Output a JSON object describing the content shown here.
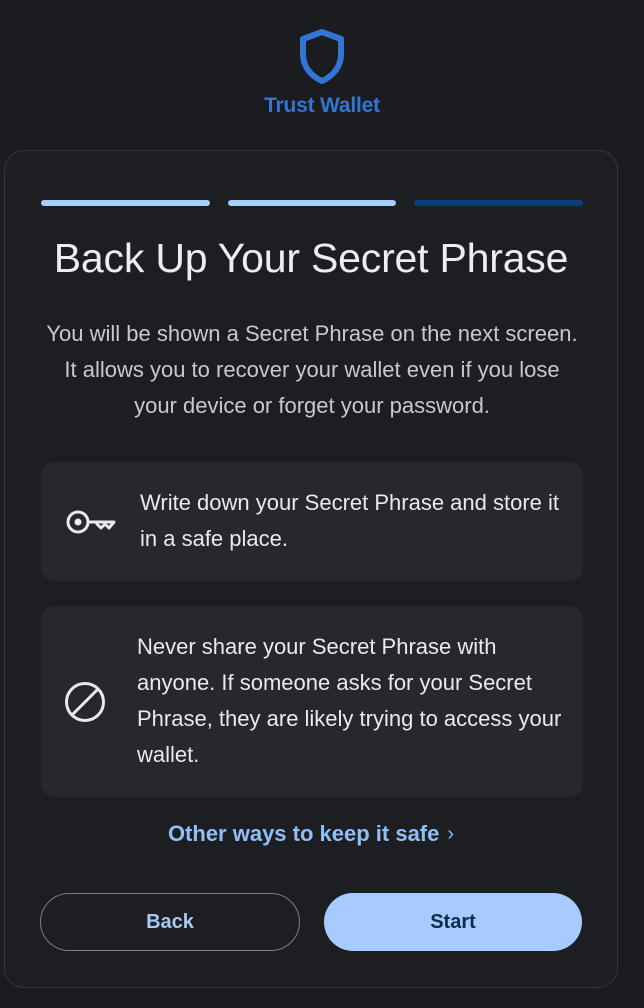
{
  "brand": {
    "name": "Trust Wallet",
    "logo_icon": "shield-icon",
    "color": "#3276d5"
  },
  "progress": {
    "total_steps": 3,
    "completed_steps": 2,
    "done_color": "#a9cdfb",
    "pending_color": "#0b3f78"
  },
  "main": {
    "title": "Back Up Your Secret Phrase",
    "subtitle": "You will be shown a Secret Phrase on the next screen. It allows you to recover your wallet even if you lose your device or forget your password."
  },
  "tips": [
    {
      "icon": "key-icon",
      "text": "Write down your Secret Phrase and store it in a safe place."
    },
    {
      "icon": "prohibited-icon",
      "text": "Never share your Secret Phrase with anyone. If someone asks for your Secret Phrase, they are likely trying to access your wallet."
    }
  ],
  "links": {
    "other_ways": "Other ways to keep it safe",
    "chevron": "›"
  },
  "actions": {
    "back_label": "Back",
    "start_label": "Start",
    "start_color": "#a5cbff"
  }
}
